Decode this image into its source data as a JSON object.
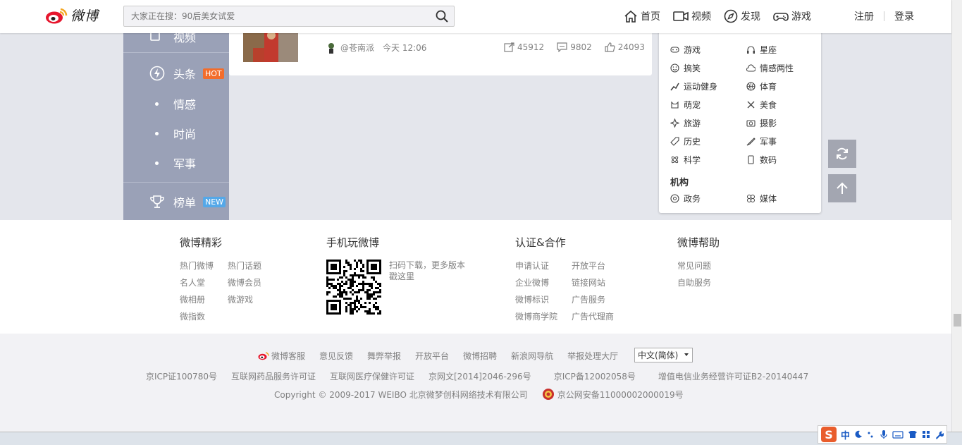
{
  "header": {
    "logo_text": "微博",
    "search": {
      "placeholder": "大家正在搜：90后美女试爱"
    },
    "nav": [
      {
        "label": "首页",
        "icon": "home-icon"
      },
      {
        "label": "视频",
        "icon": "video-icon"
      },
      {
        "label": "发现",
        "icon": "compass-icon"
      },
      {
        "label": "游戏",
        "icon": "gamepad-icon"
      }
    ],
    "register": "注册",
    "login": "登录"
  },
  "sidebar": {
    "items": [
      {
        "label": "视频",
        "icon": "video-icon"
      },
      {
        "label": "头条",
        "icon": "lightning-icon",
        "badge": "HOT",
        "badge_color": "#f36d2b"
      },
      {
        "label": "情感"
      },
      {
        "label": "时尚"
      },
      {
        "label": "军事"
      },
      {
        "label": "榜单",
        "icon": "trophy-icon",
        "badge": "NEW",
        "badge_color": "#55a8e8"
      }
    ]
  },
  "post": {
    "author": "@苍南派",
    "time": "今天 12:06",
    "shares": "45912",
    "comments": "9802",
    "likes": "24093"
  },
  "categories": {
    "items": [
      {
        "label": "游戏",
        "icon": "gamepad-icon"
      },
      {
        "label": "星座",
        "icon": "headphone-icon"
      },
      {
        "label": "搞笑",
        "icon": "smile-icon"
      },
      {
        "label": "情感两性",
        "icon": "cloud-icon"
      },
      {
        "label": "运动健身",
        "icon": "run-icon"
      },
      {
        "label": "体育",
        "icon": "ball-icon"
      },
      {
        "label": "萌宠",
        "icon": "cat-icon"
      },
      {
        "label": "美食",
        "icon": "utensils-icon"
      },
      {
        "label": "旅游",
        "icon": "plane-icon"
      },
      {
        "label": "摄影",
        "icon": "camera-icon"
      },
      {
        "label": "历史",
        "icon": "tag-icon"
      },
      {
        "label": "军事",
        "icon": "knife-icon"
      },
      {
        "label": "科学",
        "icon": "atom-icon"
      },
      {
        "label": "数码",
        "icon": "phone-icon"
      }
    ],
    "org_title": "机构",
    "org_items": [
      {
        "label": "政务",
        "icon": "gov-icon"
      },
      {
        "label": "媒体",
        "icon": "media-icon"
      }
    ]
  },
  "footer": {
    "col1": {
      "title": "微博精彩",
      "links": [
        "热门微博",
        "热门话题",
        "名人堂",
        "微博会员",
        "微相册",
        "微游戏",
        "微指数"
      ]
    },
    "col2": {
      "title": "手机玩微博",
      "qr_text": "扫码下载，更多版本戳这里"
    },
    "col3": {
      "title": "认证&合作",
      "links": [
        "申请认证",
        "开放平台",
        "企业微博",
        "链接网站",
        "微博标识",
        "广告服务",
        "微博商学院",
        "广告代理商"
      ]
    },
    "col4": {
      "title": "微博帮助",
      "links": [
        "常见问题",
        "自助服务"
      ]
    }
  },
  "bottom": {
    "links": [
      "微博客服",
      "意见反馈",
      "舞弊举报",
      "开放平台",
      "微博招聘",
      "新浪网导航",
      "举报处理大厅"
    ],
    "lang": "中文(简体)",
    "licenses": [
      "京ICP证100780号",
      "互联网药品服务许可证",
      "互联网医疗保健许可证",
      "京网文[2014]2046-296号",
      "京ICP备12002058号",
      "增值电信业务经营许可证B2-20140447"
    ],
    "copyright": "Copyright © 2009-2017 WEIBO 北京微梦创科网络技术有限公司",
    "police": "京公网安备11000002000019号"
  },
  "ime": {
    "label": "中"
  },
  "colors": {
    "sidebar": "#9aa1b7",
    "page_bg": "#e4e6ec",
    "hot": "#f36d2b",
    "new": "#55a8e8"
  }
}
